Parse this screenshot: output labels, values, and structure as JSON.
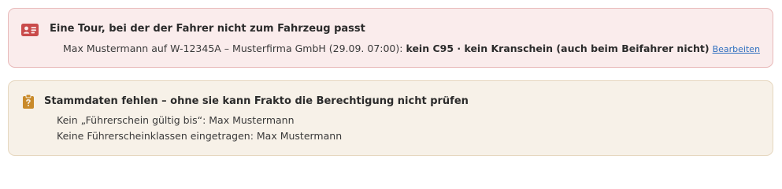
{
  "colors": {
    "error_accent": "#c94b4b",
    "warn_accent": "#c98a2a",
    "link": "#2f6fbf"
  },
  "alerts": {
    "mismatch": {
      "icon": "id-card-icon",
      "title": "Eine Tour, bei der der Fahrer nicht zum Fahrzeug passt",
      "detail_prefix": "Max Mustermann auf W-12345A – Musterfirma GmbH (29.09. 07:00):",
      "detail_issues": "kein C95 · kein Kranschein (auch beim Beifahrer nicht)",
      "edit_link": "Bearbeiten"
    },
    "missing_data": {
      "icon": "clipboard-question-icon",
      "title": "Stammdaten fehlen – ohne sie kann Frakto die Berechtigung nicht prüfen",
      "items": [
        "Kein „Führerschein gültig bis“: Max Mustermann",
        "Keine Führerscheinklassen eingetragen: Max Mustermann"
      ]
    }
  }
}
